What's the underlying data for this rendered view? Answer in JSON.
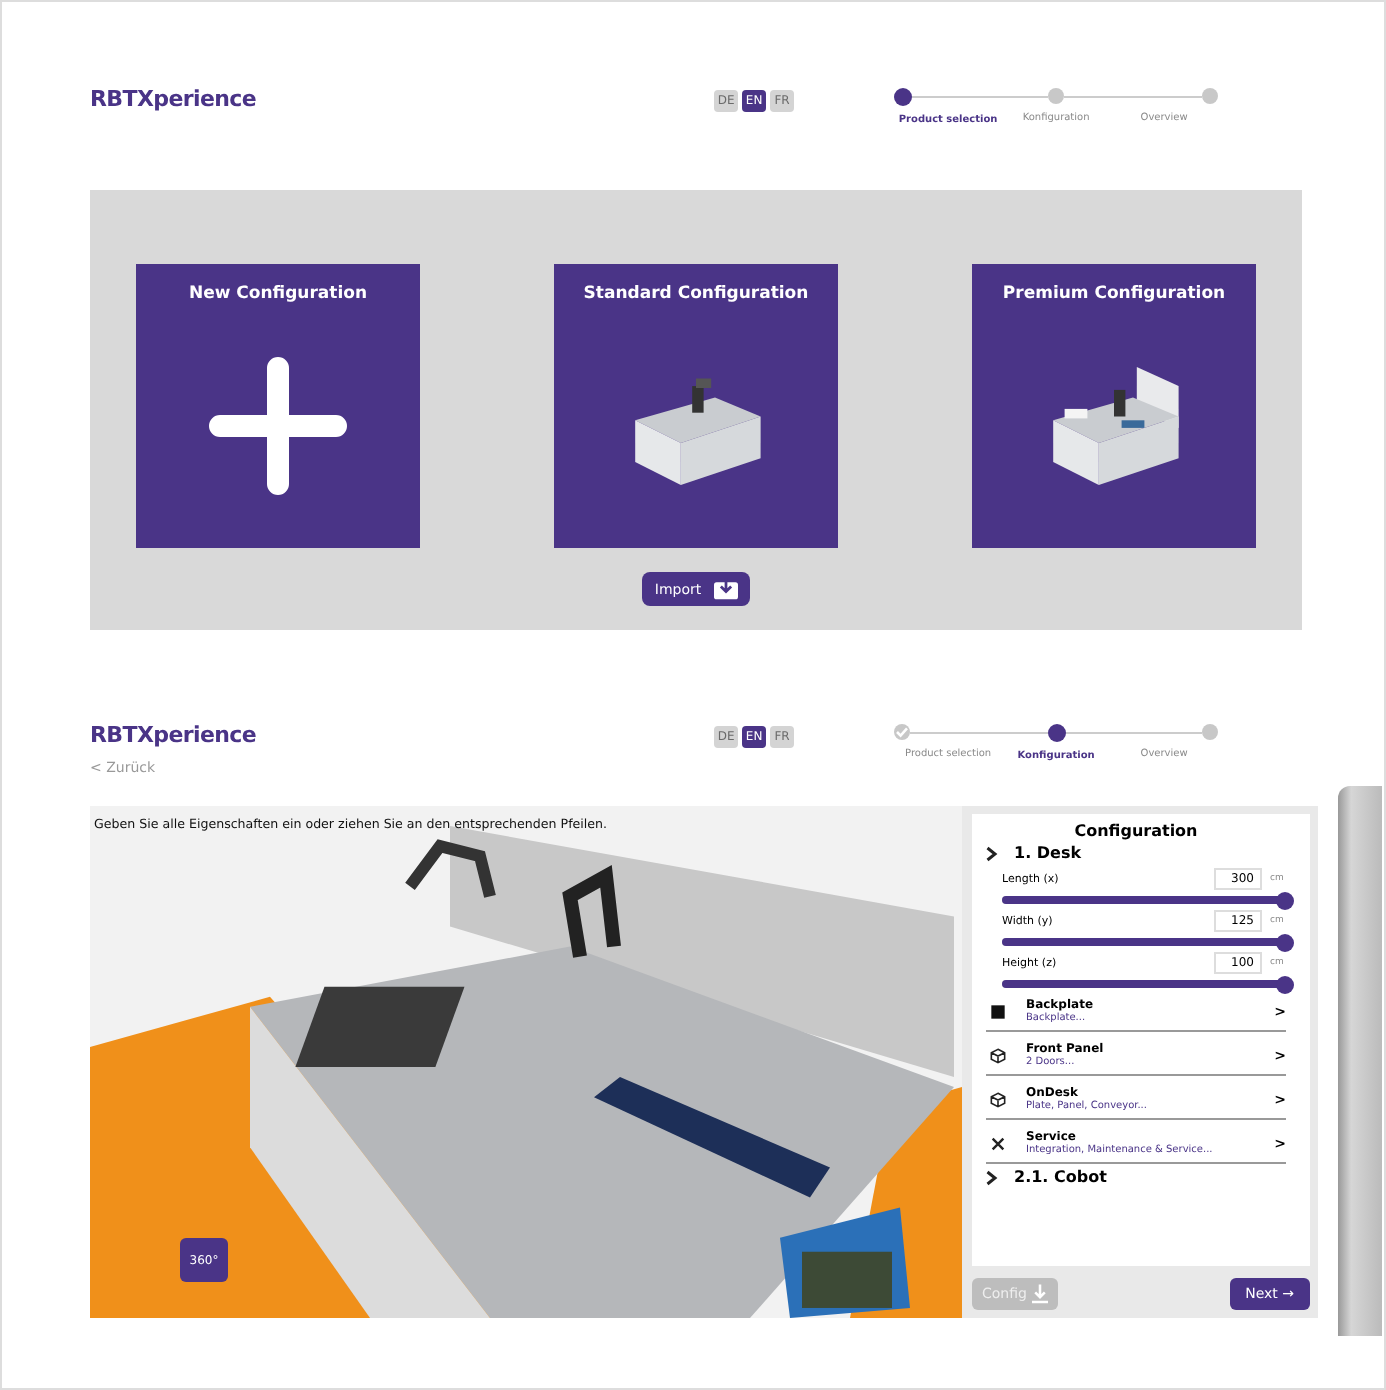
{
  "screens": [
    {
      "brand": "RBTXperience",
      "languages": [
        {
          "label": "DE",
          "selected": false
        },
        {
          "label": "EN",
          "selected": true
        },
        {
          "label": "FR",
          "selected": false
        }
      ],
      "steps": [
        {
          "label": "Product selection",
          "selected": true,
          "completed": false
        },
        {
          "label": "Konfiguration",
          "selected": false,
          "completed": false
        },
        {
          "label": "Overview",
          "selected": false,
          "completed": false
        }
      ],
      "cards": [
        {
          "title": "New Configuration",
          "kind": "plus"
        },
        {
          "title": "Standard Configuration",
          "kind": "desk"
        },
        {
          "title": "Premium Configuration",
          "kind": "premium"
        }
      ],
      "import_button": "Import"
    },
    {
      "brand": "RBTXperience",
      "back_link": "< Zurück",
      "languages": [
        {
          "label": "DE",
          "selected": false
        },
        {
          "label": "EN",
          "selected": true
        },
        {
          "label": "FR",
          "selected": false
        }
      ],
      "steps": [
        {
          "label": "Product selection",
          "selected": false,
          "completed": true
        },
        {
          "label": "Konfiguration",
          "selected": true,
          "completed": false
        },
        {
          "label": "Overview",
          "selected": false,
          "completed": false
        }
      ],
      "scene_hint": "Geben Sie alle Eigenschaften ein oder ziehen Sie an den entsprechenden Pfeilen.",
      "rotate_button": "360°",
      "config": {
        "title": "Configuration",
        "sections": [
          {
            "label": "1. Desk"
          },
          {
            "label": "2.1. Cobot"
          }
        ],
        "sliders": [
          {
            "label": "Length (x)",
            "value": "300",
            "unit": "cm",
            "level": 1
          },
          {
            "label": "Width (y)",
            "value": "125",
            "unit": "cm",
            "level": 1
          },
          {
            "label": "Height (z)",
            "value": "100",
            "unit": "cm",
            "level": 1
          }
        ],
        "items": [
          {
            "kind": "square",
            "title": "Backplate",
            "subtitle": "Backplate..."
          },
          {
            "kind": "cube",
            "title": "Front Panel",
            "subtitle": "2 Doors..."
          },
          {
            "kind": "cube",
            "title": "OnDesk",
            "subtitle": "Plate, Panel, Conveyor..."
          },
          {
            "kind": "tools",
            "title": "Service",
            "subtitle": "Integration, Maintenance & Service..."
          }
        ],
        "chevron": ">",
        "config_button": "Config",
        "next_button": "Next →"
      }
    }
  ]
}
